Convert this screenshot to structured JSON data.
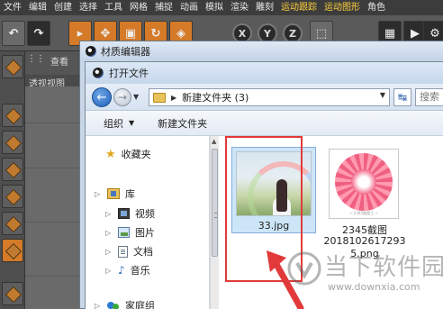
{
  "menubar": {
    "items": [
      {
        "label": "文件",
        "highlight": false
      },
      {
        "label": "编辑",
        "highlight": false
      },
      {
        "label": "创建",
        "highlight": false
      },
      {
        "label": "选择",
        "highlight": false
      },
      {
        "label": "工具",
        "highlight": false
      },
      {
        "label": "网格",
        "highlight": false
      },
      {
        "label": "捕捉",
        "highlight": false
      },
      {
        "label": "动画",
        "highlight": false
      },
      {
        "label": "模拟",
        "highlight": false
      },
      {
        "label": "渲染",
        "highlight": false
      },
      {
        "label": "雕刻",
        "highlight": false
      },
      {
        "label": "运动跟踪",
        "highlight": true
      },
      {
        "label": "运动图形",
        "highlight": true
      },
      {
        "label": "角色",
        "highlight": false
      }
    ]
  },
  "toolbar": {
    "x_label": "X",
    "y_label": "Y",
    "z_label": "Z"
  },
  "viewport": {
    "tab_view": "查看",
    "tab_perspective": "透视视图"
  },
  "material_editor": {
    "title": "材质编辑器"
  },
  "dialog": {
    "title": "打开文件",
    "address": {
      "path_segment": "新建文件夹 (3)"
    },
    "search_placeholder": "搜索",
    "commands": {
      "organize": "组织",
      "new_folder": "新建文件夹"
    },
    "nav": {
      "favorites": "收藏夹",
      "libraries": "库",
      "videos": "视频",
      "pictures": "图片",
      "documents": "文档",
      "music": "音乐",
      "homegroup": "家庭组"
    },
    "files": [
      {
        "name": "33.jpg",
        "selected": true,
        "thumb_caption": ""
      },
      {
        "name_line1": "2345截图",
        "name_line2": "2018102617293",
        "name_line3": "5.png",
        "selected": false,
        "thumb_caption": "~ 2345截图王 ~"
      }
    ]
  },
  "watermark": {
    "text": "当下软件园",
    "url": "www.downxia.com"
  },
  "colors": {
    "accent_orange": "#d47a28",
    "annotation_red": "#e23a3a",
    "selection_blue": "#cde6f7"
  }
}
